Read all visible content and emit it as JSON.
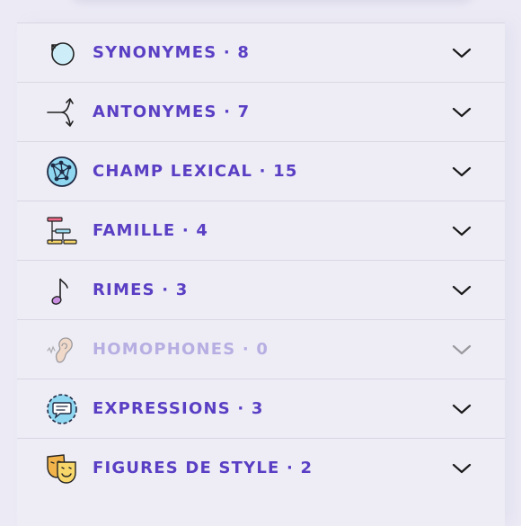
{
  "accent_color": "#5a3fc4",
  "disabled_color": "#b7aee2",
  "sections": [
    {
      "label": "SYNONYMES · 8",
      "icon": "cycle-arrow-icon",
      "expanded": false
    },
    {
      "label": "ANTONYMES · 7",
      "icon": "split-arrows-icon",
      "expanded": false
    },
    {
      "label": "CHAMP LEXICAL · 15",
      "icon": "network-globe-icon",
      "expanded": false
    },
    {
      "label": "FAMILLE · 4",
      "icon": "family-tree-icon",
      "expanded": false
    },
    {
      "label": "RIMES · 3",
      "icon": "music-note-icon",
      "expanded": false
    },
    {
      "label": "HOMOPHONES · 0",
      "icon": "ear-icon",
      "expanded": false,
      "disabled": true
    },
    {
      "label": "EXPRESSIONS · 3",
      "icon": "speech-bubble-icon",
      "expanded": false
    },
    {
      "label": "FIGURES DE STYLE · 2",
      "icon": "theater-masks-icon",
      "expanded": false
    }
  ]
}
